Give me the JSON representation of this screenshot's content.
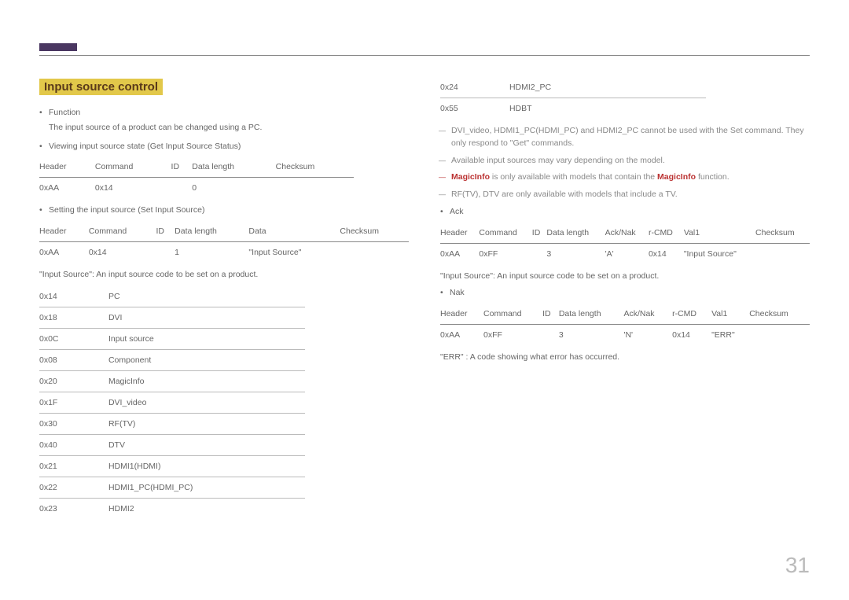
{
  "page_number": "31",
  "section_title": "Input source control",
  "left": {
    "func_label": "Function",
    "func_desc": "The input source of a product can be changed using a PC.",
    "view_label": "Viewing input source state (Get Input Source Status)",
    "t1": {
      "h": [
        "Header",
        "Command",
        "ID",
        "Data length",
        "Checksum"
      ],
      "r": [
        "0xAA",
        "0x14",
        "",
        "0",
        ""
      ]
    },
    "set_label": "Setting the input source (Set Input Source)",
    "t2": {
      "h": [
        "Header",
        "Command",
        "ID",
        "Data length",
        "Data",
        "Checksum"
      ],
      "r": [
        "0xAA",
        "0x14",
        "",
        "1",
        "\"Input Source\"",
        ""
      ]
    },
    "src_note": "\"Input Source\": An input source code to be set on a product.",
    "codes": [
      [
        "0x14",
        "PC"
      ],
      [
        "0x18",
        "DVI"
      ],
      [
        "0x0C",
        "Input source"
      ],
      [
        "0x08",
        "Component"
      ],
      [
        "0x20",
        "MagicInfo"
      ],
      [
        "0x1F",
        "DVI_video"
      ],
      [
        "0x30",
        "RF(TV)"
      ],
      [
        "0x40",
        "DTV"
      ],
      [
        "0x21",
        "HDMI1(HDMI)"
      ],
      [
        "0x22",
        "HDMI1_PC(HDMI_PC)"
      ],
      [
        "0x23",
        "HDMI2"
      ]
    ]
  },
  "right": {
    "codes": [
      [
        "0x24",
        "HDMI2_PC"
      ],
      [
        "0x55",
        "HDBT"
      ]
    ],
    "dash1": "DVI_video, HDMI1_PC(HDMI_PC) and HDMI2_PC cannot be used with the Set command. They only respond to \"Get\" commands.",
    "dash2": "Available input sources may vary depending on the model.",
    "dash3_pre": "MagicInfo",
    "dash3_mid": " is only available with models that contain the ",
    "dash3_hl": "MagicInfo",
    "dash3_post": " function.",
    "dash4": "RF(TV), DTV are only available with models that include a TV.",
    "ack_label": "Ack",
    "tAck": {
      "h": [
        "Header",
        "Command",
        "ID",
        "Data length",
        "Ack/Nak",
        "r-CMD",
        "Val1",
        "Checksum"
      ],
      "r": [
        "0xAA",
        "0xFF",
        "",
        "3",
        "'A'",
        "0x14",
        "\"Input Source\"",
        ""
      ]
    },
    "src_note2": "\"Input Source\": An input source code to be set on a product.",
    "nak_label": "Nak",
    "tNak": {
      "h": [
        "Header",
        "Command",
        "ID",
        "Data length",
        "Ack/Nak",
        "r-CMD",
        "Val1",
        "Checksum"
      ],
      "r": [
        "0xAA",
        "0xFF",
        "",
        "3",
        "'N'",
        "0x14",
        "\"ERR\"",
        ""
      ]
    },
    "err_note": "\"ERR\" : A code showing what error has occurred."
  }
}
